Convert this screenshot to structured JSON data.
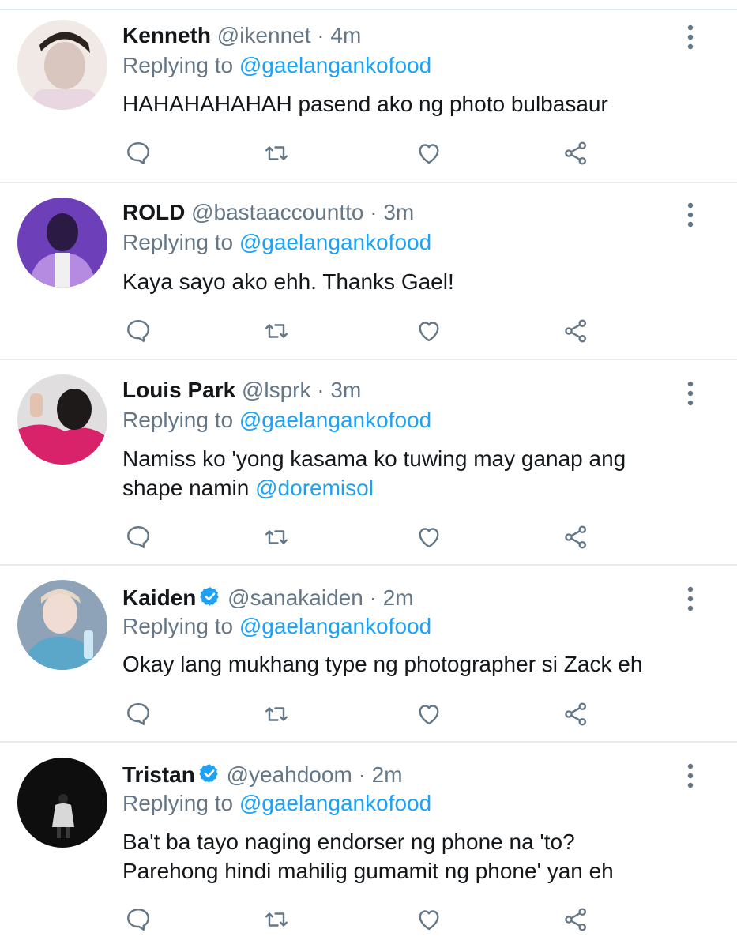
{
  "theme": {
    "text": "#14171a",
    "muted": "#657786",
    "link": "#1da1f2",
    "divider": "#e6ecf0"
  },
  "tweets": [
    {
      "name": "Kenneth",
      "handle": "@ikennet",
      "time": "4m",
      "verified": false,
      "reply_prefix": "Replying to",
      "reply_to": "@gaelangankofood",
      "text": "HAHAHAHAHAH pasend ako ng photo bulbasaur",
      "text2": "",
      "mention": "",
      "avatar_colors": [
        "#f1e9e6",
        "#d9c6bf",
        "#2b221e"
      ]
    },
    {
      "name": "ROLD",
      "handle": "@bastaaccountto",
      "time": "3m",
      "verified": false,
      "reply_prefix": "Replying to",
      "reply_to": "@gaelangankofood",
      "text": "Kaya sayo ako ehh. Thanks Gael!",
      "text2": "",
      "mention": "",
      "avatar_colors": [
        "#6d3fb8",
        "#b48be0",
        "#2a1a44"
      ]
    },
    {
      "name": "Louis Park",
      "handle": "@lsprk",
      "time": "3m",
      "verified": false,
      "reply_prefix": "Replying to",
      "reply_to": "@gaelangankofood",
      "text": "Namiss ko 'yong kasama ko tuwing may ganap ang",
      "text2": "shape namin",
      "mention": "@doremisol",
      "avatar_colors": [
        "#e0dede",
        "#d8226a",
        "#1f1a1a"
      ]
    },
    {
      "name": "Kaiden",
      "handle": "@sanakaiden",
      "time": "2m",
      "verified": true,
      "reply_prefix": "Replying to",
      "reply_to": "@gaelangankofood",
      "text": "Okay lang mukhang type ng photographer si Zack eh",
      "text2": "",
      "mention": "",
      "avatar_colors": [
        "#8fa3b8",
        "#5aa7c9",
        "#3a3f4a"
      ]
    },
    {
      "name": "Tristan",
      "handle": "@yeahdoom",
      "time": "2m",
      "verified": true,
      "reply_prefix": "Replying to",
      "reply_to": "@gaelangankofood",
      "text": "Ba't ba tayo naging endorser ng phone na 'to?",
      "text2": "Parehong hindi mahilig gumamit ng phone' yan eh",
      "mention": "",
      "avatar_colors": [
        "#0e0e0e",
        "#d8d8d8",
        "#2a2a2a"
      ]
    }
  ],
  "icons": {
    "reply": "reply-icon",
    "retweet": "retweet-icon",
    "like": "like-icon",
    "share": "share-icon",
    "more": "more-options-icon",
    "verified": "verified-badge-icon"
  }
}
